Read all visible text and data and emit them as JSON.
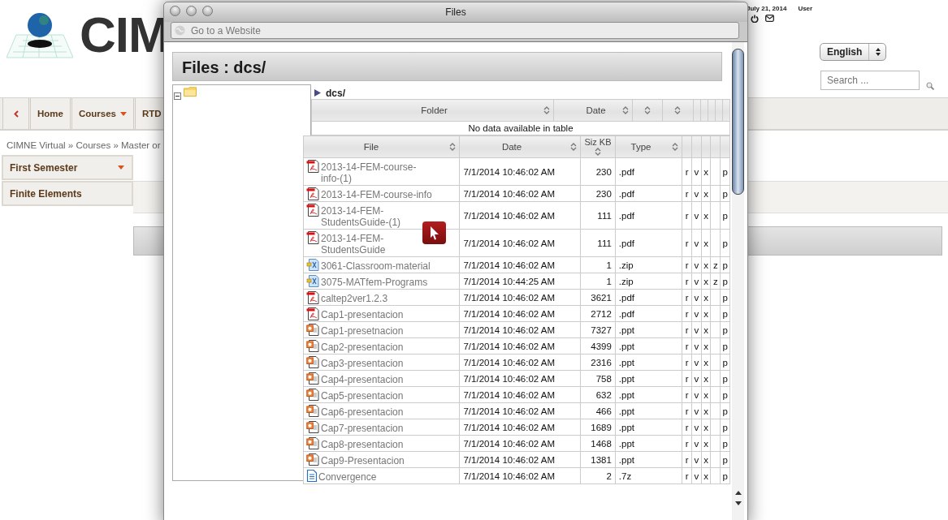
{
  "page": {
    "logo_text": "CIM",
    "date": "July 21, 2014",
    "user_label": "User",
    "language": "English",
    "search": {
      "placeholder": "Search ..."
    },
    "nav": [
      {
        "kind": "back"
      },
      {
        "kind": "link",
        "label": "Home"
      },
      {
        "kind": "menu",
        "label": "Courses"
      },
      {
        "kind": "link",
        "label": "RTD"
      }
    ],
    "breadcrumb": "CIMNE Virtual » Courses » Master or",
    "sidebar": [
      {
        "label": "First Semester",
        "expandable": true
      },
      {
        "label": "Finite Elements",
        "expandable": false
      }
    ]
  },
  "window": {
    "title": "Files",
    "address_placeholder": "Go to a Website"
  },
  "heading": "Files : dcs/",
  "tree": {
    "expanded": true
  },
  "path": "dcs/",
  "folder_table": {
    "columns": [
      "Folder",
      "Date"
    ],
    "empty_message": "No data available in table"
  },
  "file_table": {
    "columns": [
      "File",
      "Date",
      "Siz KB",
      "Type"
    ],
    "rows": [
      {
        "kind": "pdf",
        "name": "2013-14-FEM-course-info-(1)",
        "date": "7/1/2014 10:46:02 AM",
        "size": "230",
        "type": ".pdf",
        "marks": {
          "column_5": "r",
          "column_6": "v",
          "column_7": "x",
          "column_9": "p"
        }
      },
      {
        "kind": "pdf",
        "name": "2013-14-FEM-course-info",
        "date": "7/1/2014 10:46:02 AM",
        "size": "230",
        "type": ".pdf",
        "marks": {
          "column_5": "r",
          "column_6": "v",
          "column_7": "x",
          "column_9": "p"
        }
      },
      {
        "kind": "pdf",
        "name": "2013-14-FEM-StudentsGuide-(1)",
        "date": "7/1/2014 10:46:02 AM",
        "size": "111",
        "type": ".pdf",
        "marks": {
          "column_5": "r",
          "column_6": "v",
          "column_7": "x",
          "column_9": "p"
        }
      },
      {
        "kind": "pdf",
        "name": "2013-14-FEM-StudentsGuide",
        "date": "7/1/2014 10:46:02 AM",
        "size": "111",
        "type": ".pdf",
        "marks": {
          "column_5": "r",
          "column_6": "v",
          "column_7": "x",
          "column_9": "p"
        }
      },
      {
        "kind": "zip",
        "name": "3061-Classroom-material",
        "date": "7/1/2014 10:46:02 AM",
        "size": "1",
        "type": ".zip",
        "marks": {
          "column_5": "r",
          "column_6": "v",
          "column_7": "x",
          "column_8": "z",
          "column_9": "p"
        }
      },
      {
        "kind": "zip",
        "name": "3075-MATfem-Programs",
        "date": "7/1/2014 10:44:25 AM",
        "size": "1",
        "type": ".zip",
        "marks": {
          "column_5": "r",
          "column_6": "v",
          "column_7": "x",
          "column_8": "z",
          "column_9": "p"
        }
      },
      {
        "kind": "pdf",
        "name": "caltep2ver1.2.3",
        "date": "7/1/2014 10:46:02 AM",
        "size": "3621",
        "type": ".pdf",
        "marks": {
          "column_5": "r",
          "column_6": "v",
          "column_7": "x",
          "column_9": "p"
        }
      },
      {
        "kind": "pdf",
        "name": "Cap1-presentacion",
        "date": "7/1/2014 10:46:02 AM",
        "size": "2712",
        "type": ".pdf",
        "marks": {
          "column_5": "r",
          "column_6": "v",
          "column_7": "x",
          "column_9": "p"
        }
      },
      {
        "kind": "ppt",
        "name": "Cap1-presetnacion",
        "date": "7/1/2014 10:46:02 AM",
        "size": "7327",
        "type": ".ppt",
        "marks": {
          "column_5": "r",
          "column_6": "v",
          "column_7": "x",
          "column_9": "p"
        }
      },
      {
        "kind": "ppt",
        "name": "Cap2-presentacion",
        "date": "7/1/2014 10:46:02 AM",
        "size": "4399",
        "type": ".ppt",
        "marks": {
          "column_5": "r",
          "column_6": "v",
          "column_7": "x",
          "column_9": "p"
        }
      },
      {
        "kind": "ppt",
        "name": "Cap3-presentacion",
        "date": "7/1/2014 10:46:02 AM",
        "size": "2316",
        "type": ".ppt",
        "marks": {
          "column_5": "r",
          "column_6": "v",
          "column_7": "x",
          "column_9": "p"
        }
      },
      {
        "kind": "ppt",
        "name": "Cap4-presentacion",
        "date": "7/1/2014 10:46:02 AM",
        "size": "758",
        "type": ".ppt",
        "marks": {
          "column_5": "r",
          "column_6": "v",
          "column_7": "x",
          "column_9": "p"
        }
      },
      {
        "kind": "ppt",
        "name": "Cap5-presentacion",
        "date": "7/1/2014 10:46:02 AM",
        "size": "632",
        "type": ".ppt",
        "marks": {
          "column_5": "r",
          "column_6": "v",
          "column_7": "x",
          "column_9": "p"
        }
      },
      {
        "kind": "ppt",
        "name": "Cap6-presentacion",
        "date": "7/1/2014 10:46:02 AM",
        "size": "466",
        "type": ".ppt",
        "marks": {
          "column_5": "r",
          "column_6": "v",
          "column_7": "x",
          "column_9": "p"
        }
      },
      {
        "kind": "ppt",
        "name": "Cap7-presentacion",
        "date": "7/1/2014 10:46:02 AM",
        "size": "1689",
        "type": ".ppt",
        "marks": {
          "column_5": "r",
          "column_6": "v",
          "column_7": "x",
          "column_9": "p"
        }
      },
      {
        "kind": "ppt",
        "name": "Cap8-presentacion",
        "date": "7/1/2014 10:46:02 AM",
        "size": "1468",
        "type": ".ppt",
        "marks": {
          "column_5": "r",
          "column_6": "v",
          "column_7": "x",
          "column_9": "p"
        }
      },
      {
        "kind": "ppt",
        "name": "Cap9-Presentacion",
        "date": "7/1/2014 10:46:02 AM",
        "size": "1381",
        "type": ".ppt",
        "marks": {
          "column_5": "r",
          "column_6": "v",
          "column_7": "x",
          "column_9": "p"
        }
      },
      {
        "kind": "doc",
        "name": "Convergence",
        "date": "7/1/2014 10:46:02 AM",
        "size": "2",
        "type": ".7z",
        "marks": {
          "column_5": "r",
          "column_6": "v",
          "column_7": "x",
          "column_9": "p"
        }
      }
    ]
  }
}
